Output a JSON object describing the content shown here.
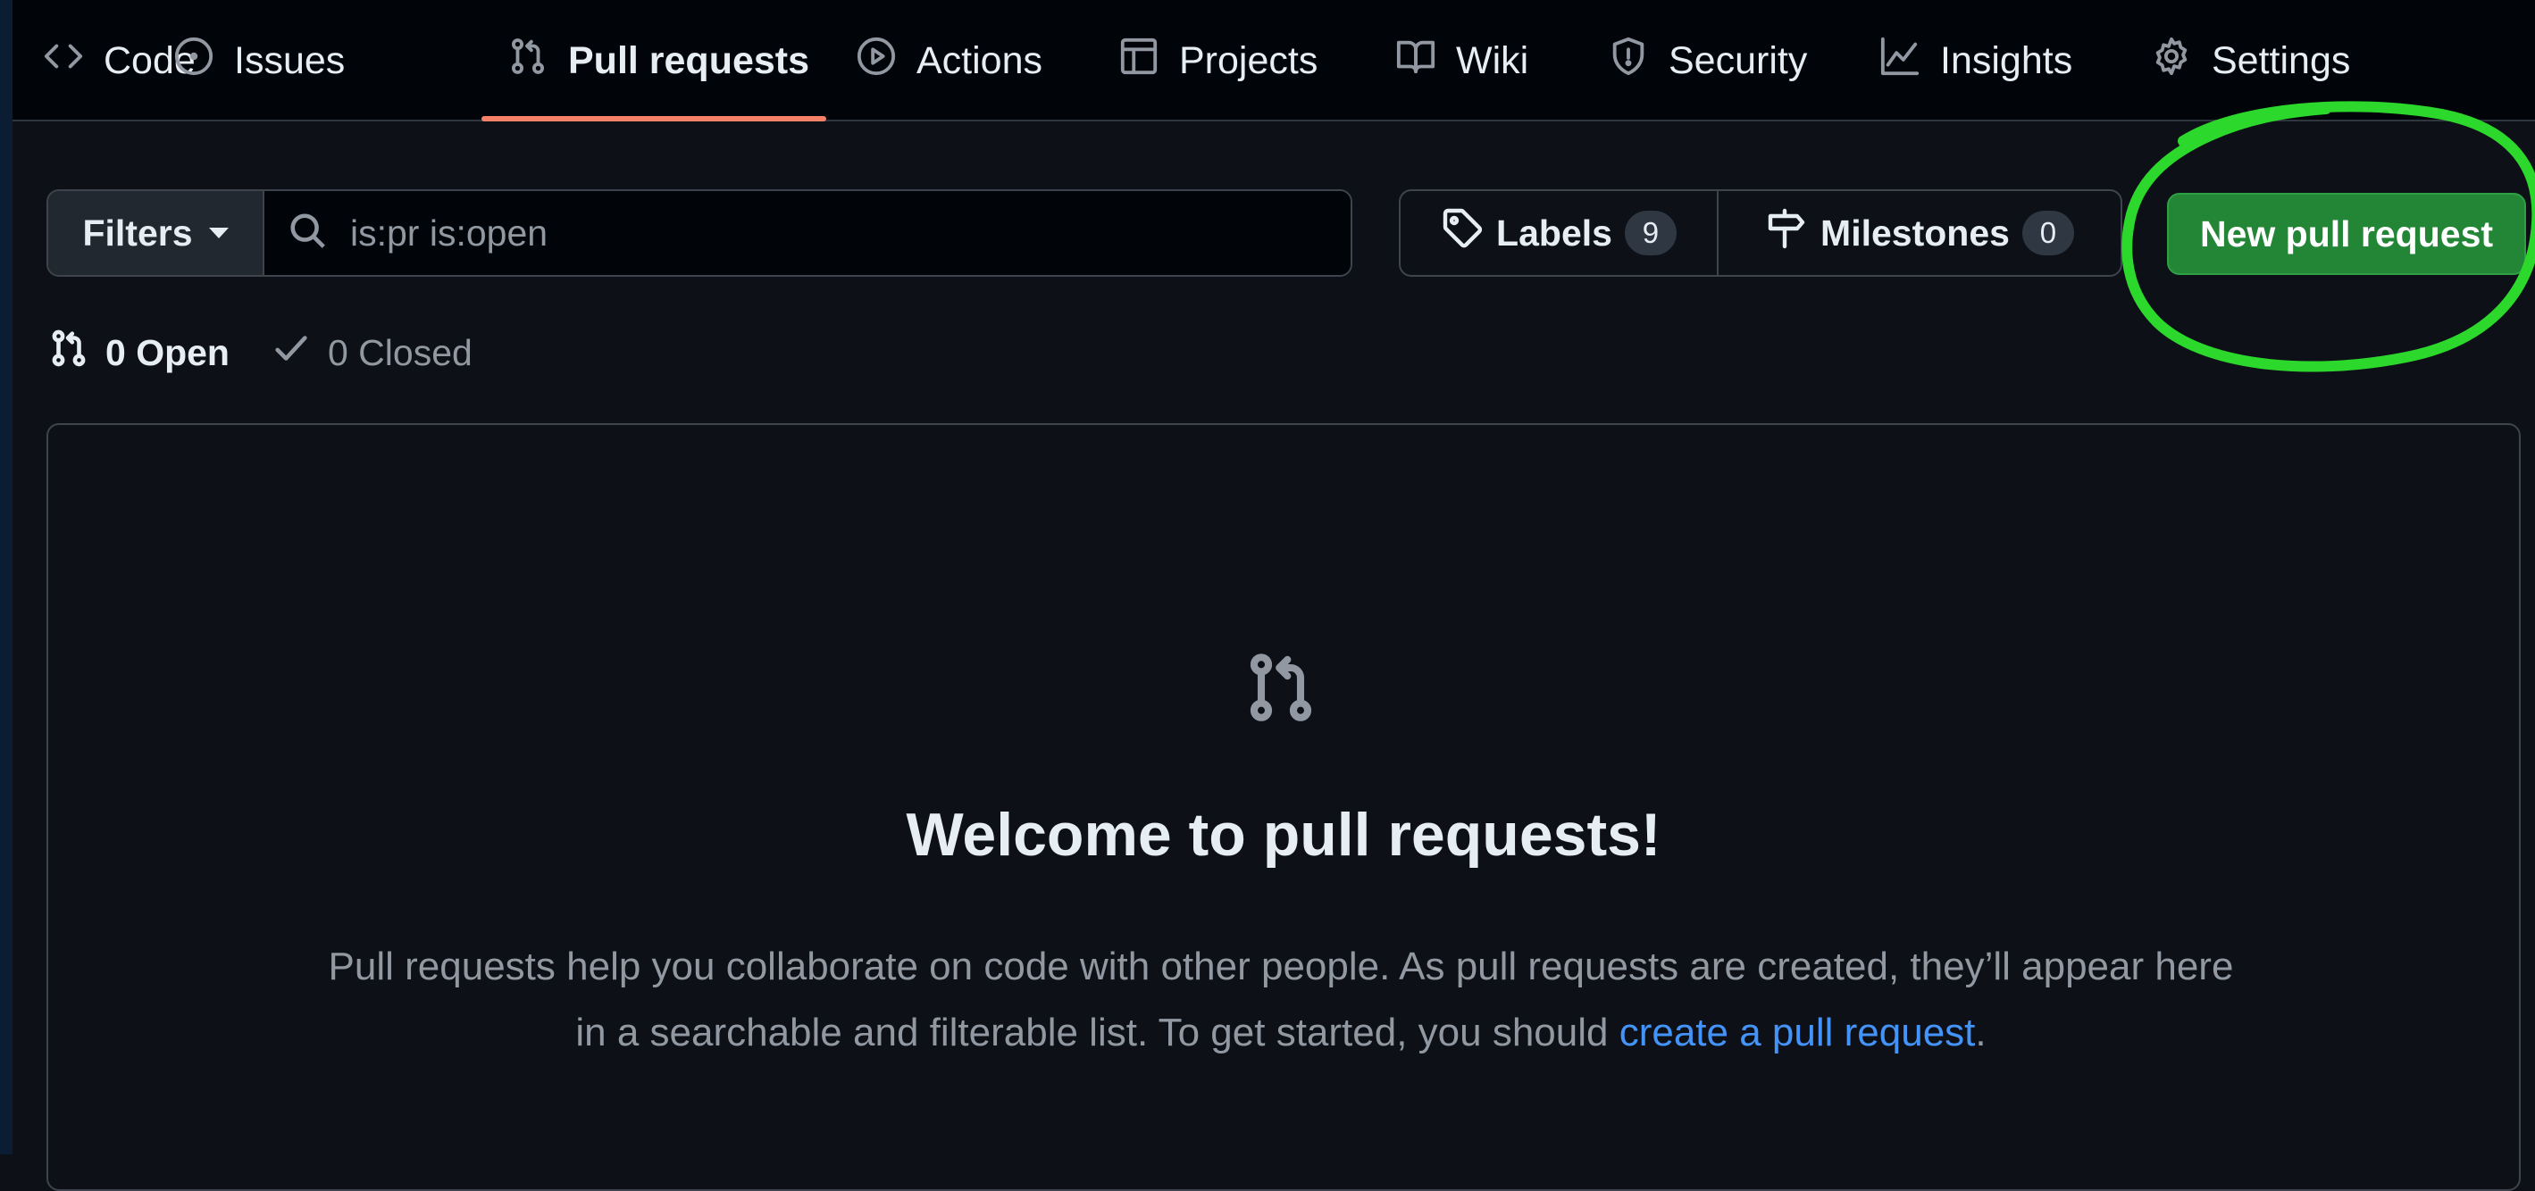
{
  "tabs": [
    {
      "id": "code",
      "label": "Code",
      "icon": "code-icon"
    },
    {
      "id": "issues",
      "label": "Issues",
      "icon": "issue-opened-icon"
    },
    {
      "id": "pull-requests",
      "label": "Pull requests",
      "icon": "git-pull-request-icon",
      "selected": true
    },
    {
      "id": "actions",
      "label": "Actions",
      "icon": "play-icon"
    },
    {
      "id": "projects",
      "label": "Projects",
      "icon": "table-icon"
    },
    {
      "id": "wiki",
      "label": "Wiki",
      "icon": "book-icon"
    },
    {
      "id": "security",
      "label": "Security",
      "icon": "shield-icon"
    },
    {
      "id": "insights",
      "label": "Insights",
      "icon": "graph-icon"
    },
    {
      "id": "settings",
      "label": "Settings",
      "icon": "gear-icon"
    }
  ],
  "toolbar": {
    "filters_label": "Filters",
    "search_placeholder": "is:pr is:open",
    "search_value": "",
    "labels_label": "Labels",
    "labels_count": "9",
    "milestones_label": "Milestones",
    "milestones_count": "0",
    "new_pr_label": "New pull request"
  },
  "states": {
    "open_label": "0 Open",
    "closed_label": "0 Closed"
  },
  "blankslate": {
    "title": "Welcome to pull requests!",
    "description_before": "Pull requests help you collaborate on code with other people. As pull requests are created, they’ll appear here in a searchable and filterable list. To get started, you should ",
    "link_text": "create a pull request",
    "description_after": "."
  },
  "colors": {
    "background": "#0d1117",
    "nav_background": "#010409",
    "accent_underline": "#f78166",
    "primary_button": "#238636",
    "highlight_annotation": "#2bd82b",
    "link": "#4493f8"
  }
}
